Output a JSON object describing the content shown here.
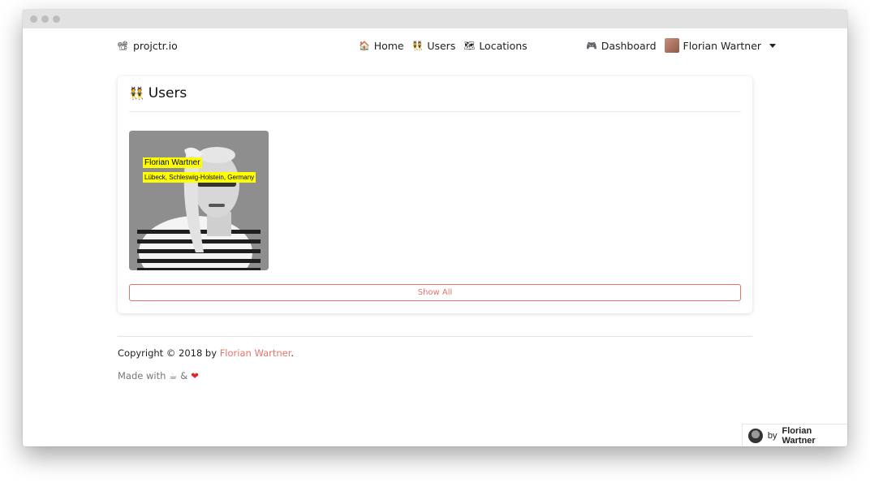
{
  "window": {
    "controls": [
      "close",
      "minimize",
      "maximize"
    ]
  },
  "nav": {
    "brand": {
      "icon": "projector-icon",
      "glyph": "📽",
      "label": "projctr.io"
    },
    "links": [
      {
        "icon": "house-icon",
        "glyph": "🏠",
        "label": "Home"
      },
      {
        "icon": "people-icon",
        "glyph": "👯",
        "label": "Users"
      },
      {
        "icon": "map-icon",
        "glyph": "🗺",
        "label": "Locations"
      }
    ],
    "dashboard": {
      "icon": "gamepad-icon",
      "glyph": "🎮",
      "label": "Dashboard"
    },
    "user_menu": {
      "label": "Florian Wartner"
    }
  },
  "users_card": {
    "title_glyph": "👯",
    "title": "Users",
    "users": [
      {
        "name": "Florian Wartner",
        "location": "Lübeck, Schleswig-Holstein, Germany"
      }
    ],
    "show_all_label": "Show All"
  },
  "footer": {
    "copyright_prefix": "Copyright © 2018 by ",
    "copyright_link": "Florian Wartner",
    "copyright_suffix": ".",
    "made_with_prefix": "Made with",
    "coffee_glyph": "☕",
    "and": "&",
    "heart_glyph": "❤"
  },
  "badge": {
    "prefix": "by",
    "name": "Florian Wartner"
  },
  "colors": {
    "accent": "#e5736b",
    "highlight": "#ffff00",
    "heart": "#e0242c"
  }
}
